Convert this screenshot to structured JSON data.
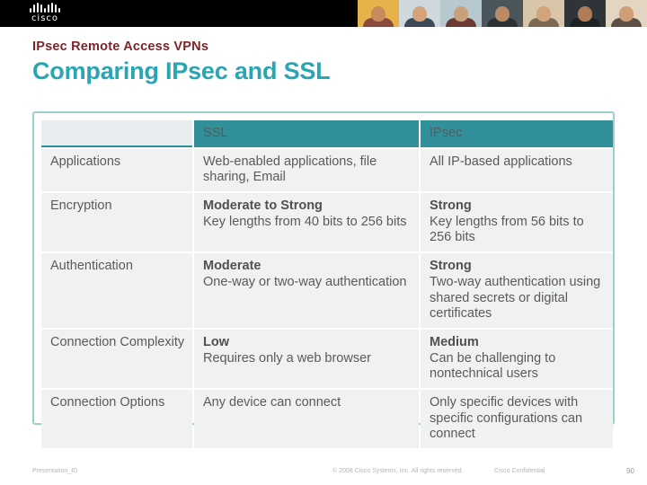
{
  "banner": {
    "logo_text": "cisco",
    "photos": [
      {
        "name": "person-photo-1",
        "sky": "#e8b24a",
        "skin": "#c98a5e",
        "shirt": "#8a4a3c"
      },
      {
        "name": "person-photo-2",
        "sky": "#cfd8dd",
        "skin": "#d8a27a",
        "shirt": "#3c4a58"
      },
      {
        "name": "person-photo-3",
        "sky": "#b7c9cf",
        "skin": "#caa07c",
        "shirt": "#6b3a34"
      },
      {
        "name": "person-photo-4",
        "sky": "#4b555c",
        "skin": "#b98a66",
        "shirt": "#2b3136"
      },
      {
        "name": "person-photo-5",
        "sky": "#d9c6a8",
        "skin": "#d2a47c",
        "shirt": "#7a6a52"
      },
      {
        "name": "person-photo-6",
        "sky": "#2e3438",
        "skin": "#b07c58",
        "shirt": "#1d2225"
      },
      {
        "name": "person-photo-7",
        "sky": "#e2d6c2",
        "skin": "#cf9e74",
        "shirt": "#5c5044"
      }
    ]
  },
  "slide": {
    "eyebrow": "IPsec Remote Access VPNs",
    "title": "Comparing IPsec and SSL"
  },
  "table": {
    "headers": [
      "",
      "SSL",
      "IPsec"
    ],
    "rows": [
      {
        "label": "Applications",
        "ssl": {
          "strong": "",
          "text": "Web-enabled applications, file sharing, Email"
        },
        "ipsec": {
          "strong": "",
          "text": "All IP-based applications"
        }
      },
      {
        "label": "Encryption",
        "ssl": {
          "strong": "Moderate to Strong",
          "text": "Key lengths from 40 bits to 256 bits"
        },
        "ipsec": {
          "strong": "Strong",
          "text": "Key lengths from 56 bits to 256 bits"
        }
      },
      {
        "label": "Authentication",
        "ssl": {
          "strong": "Moderate",
          "text": "One-way or two-way authentication"
        },
        "ipsec": {
          "strong": "Strong",
          "text": "Two-way authentication using shared secrets or digital certificates"
        }
      },
      {
        "label": "Connection Complexity",
        "ssl": {
          "strong": "Low",
          "text": "Requires only a web browser"
        },
        "ipsec": {
          "strong": "Medium",
          "text": "Can be challenging to nontechnical users"
        }
      },
      {
        "label": "Connection Options",
        "ssl": {
          "strong": "",
          "text": "Any device can connect"
        },
        "ipsec": {
          "strong": "",
          "text": "Only specific devices with specific configurations can connect"
        }
      }
    ]
  },
  "footer": {
    "left": "Presentation_ID",
    "center": "© 2008 Cisco Systems, Inc. All rights reserved.",
    "right": "Cisco Confidential",
    "page": "90"
  }
}
